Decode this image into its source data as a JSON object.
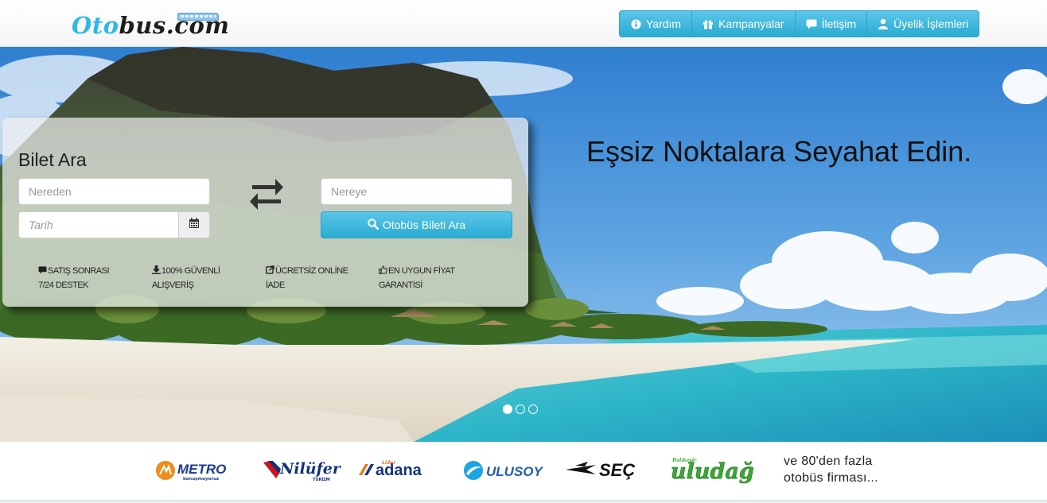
{
  "brand": {
    "logo_part1": "Oto",
    "logo_part2": "bus.com"
  },
  "nav": [
    {
      "label": "Yardım",
      "icon": "info-circle-icon"
    },
    {
      "label": "Kampanyalar",
      "icon": "gift-icon"
    },
    {
      "label": "İletişim",
      "icon": "comment-icon"
    },
    {
      "label": "Üyelik İşlemleri",
      "icon": "user-icon"
    }
  ],
  "hero": {
    "headline": "Eşsiz Noktalara Seyahat Edin.",
    "slide_count": 3,
    "active_slide": 0
  },
  "search": {
    "title": "Bilet Ara",
    "from_placeholder": "Nereden",
    "to_placeholder": "Nereye",
    "date_placeholder": "Tarih",
    "submit_label": "Otobüs Bileti Ara",
    "swap_icon": "exchange-arrows-icon",
    "calendar_icon": "calendar-icon"
  },
  "features": [
    {
      "line1": "SATIŞ SONRASI",
      "line2": "7/24 DESTEK",
      "icon": "comment-icon"
    },
    {
      "line1": "100% GÜVENLİ",
      "line2": "ALIŞVERİŞ",
      "icon": "download-icon"
    },
    {
      "line1": "ÜCRETSİZ ONLİNE",
      "line2": "İADE",
      "icon": "share-icon"
    },
    {
      "line1": "EN UYGUN FİYAT",
      "line2": "GARANTİSİ",
      "icon": "thumbs-up-icon"
    }
  ],
  "partners": {
    "logos": [
      {
        "name": "METRO",
        "sub": "konuşmuyoruz",
        "color": "#1a3a8c",
        "accent": "#f08a1c"
      },
      {
        "name": "Nilüfer",
        "sub": "TURİZM",
        "color": "#12307a",
        "accent": "#d0131d"
      },
      {
        "name": "adana",
        "sub": "Lider",
        "color": "#13357a",
        "accent": "#e87b1e"
      },
      {
        "name": "ULUSOY",
        "color": "#1e5fa8",
        "accent": "#1aa6e0"
      },
      {
        "name": "SEÇ",
        "color": "#111111"
      },
      {
        "name": "uludağ",
        "sub": "Balıkesir",
        "color": "#39a935"
      }
    ],
    "text_line1": "ve 80'den fazla",
    "text_line2": "otobüs firması..."
  },
  "colors": {
    "accent": "#2aabd2",
    "logo_blue": "#2cb8e8"
  }
}
